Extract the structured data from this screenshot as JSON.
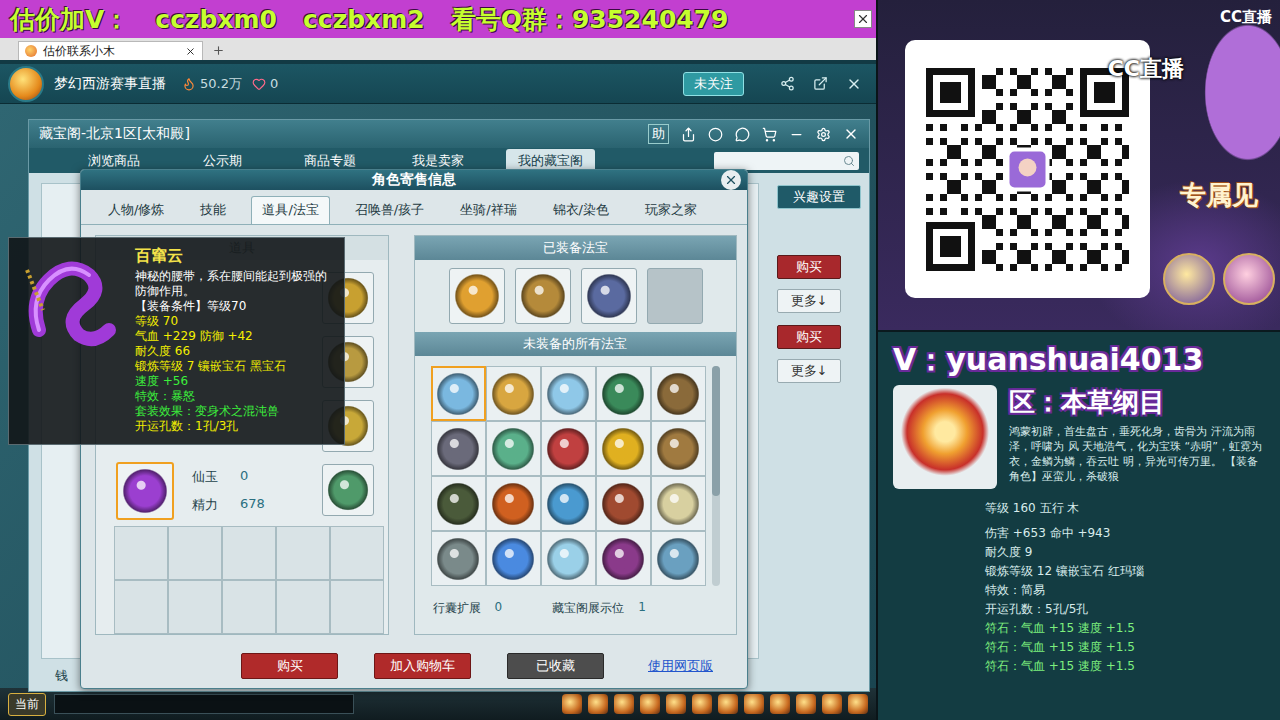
{
  "banner": {
    "segments": [
      "估价加V：",
      "cczbxm0",
      "cczbxm2",
      "看号Q群：935240479"
    ]
  },
  "browser": {
    "tabs": [
      {
        "label": "估价联系小木",
        "selected": true
      }
    ]
  },
  "stream": {
    "title": "梦幻西游赛事直播",
    "heat": "50.2万",
    "likes": "0",
    "follow": "未关注"
  },
  "shop": {
    "title": "藏宝阁-北京1区[太和殿]",
    "help": "助",
    "tabs": [
      {
        "label": "浏览商品",
        "selected": false
      },
      {
        "label": "公示期",
        "selected": false
      },
      {
        "label": "商品专题",
        "selected": false
      },
      {
        "label": "我是卖家",
        "selected": false
      },
      {
        "label": "我的藏宝阁",
        "selected": true
      }
    ],
    "interest": "兴趣设置",
    "listings": [
      {
        "buy": "购买",
        "more": "更多↓"
      },
      {
        "buy": "购买",
        "more": "更多↓"
      }
    ],
    "money": "钱"
  },
  "dialog": {
    "title": "角色寄售信息",
    "tabs": [
      {
        "label": "人物/修炼",
        "selected": false
      },
      {
        "label": "技能",
        "selected": false
      },
      {
        "label": "道具/法宝",
        "selected": true
      },
      {
        "label": "召唤兽/孩子",
        "selected": false
      },
      {
        "label": "坐骑/祥瑞",
        "selected": false
      },
      {
        "label": "锦衣/染色",
        "selected": false
      },
      {
        "label": "玩家之家",
        "selected": false
      }
    ],
    "inventory": {
      "header": "道具",
      "stats": [
        {
          "label": "仙玉",
          "value": "0"
        },
        {
          "label": "精力",
          "value": "678"
        }
      ],
      "belt": {
        "color": "#9b3fd0",
        "selected": true
      },
      "side_items": [
        {
          "color": "#c8a030"
        },
        {
          "color": "#b89a40"
        },
        {
          "color": "#c8a838"
        },
        {
          "color": "#4f9a6a"
        }
      ]
    },
    "equipped": {
      "title": "已装备法宝",
      "slots": [
        {
          "filled": true,
          "color": "#e0a030"
        },
        {
          "filled": true,
          "color": "#b58a3a"
        },
        {
          "filled": true,
          "color": "#5a6aa0"
        },
        {
          "filled": false,
          "color": "#9aa8ad"
        }
      ]
    },
    "unequipped": {
      "title": "未装备的所有法宝",
      "items": [
        {
          "color": "#7ab8e0",
          "selected": true
        },
        {
          "color": "#d8a640",
          "selected": false
        },
        {
          "color": "#8fc8e8",
          "selected": false
        },
        {
          "color": "#3a8a5a",
          "selected": false
        },
        {
          "color": "#8a6a3a",
          "selected": false
        },
        {
          "color": "#6a6a7a",
          "selected": false
        },
        {
          "color": "#5ab08a",
          "selected": false
        },
        {
          "color": "#c04040",
          "selected": false
        },
        {
          "color": "#e0b020",
          "selected": false
        },
        {
          "color": "#a07a40",
          "selected": false
        },
        {
          "color": "#4a5a3a",
          "selected": false
        },
        {
          "color": "#d06020",
          "selected": false
        },
        {
          "color": "#4a9ad0",
          "selected": false
        },
        {
          "color": "#a04a30",
          "selected": false
        },
        {
          "color": "#d8d0a0",
          "selected": false
        },
        {
          "color": "#7a8a8a",
          "selected": false
        },
        {
          "color": "#4a8ae0",
          "selected": false
        },
        {
          "color": "#9ad0e8",
          "selected": false
        },
        {
          "color": "#8a3a8a",
          "selected": false
        },
        {
          "color": "#6aa0c0",
          "selected": false
        }
      ]
    },
    "footer": [
      {
        "label": "行囊扩展",
        "value": "0"
      },
      {
        "label": "藏宝阁展示位",
        "value": "1"
      }
    ],
    "buttons": [
      {
        "label": "购买",
        "kind": "primary"
      },
      {
        "label": "加入购物车",
        "kind": "primary"
      },
      {
        "label": "已收藏",
        "kind": "muted"
      }
    ],
    "link": "使用网页版"
  },
  "tooltip": {
    "name": "百窜云",
    "lines": [
      {
        "text": "神秘的腰带，系在腰间能起到极强的防御作用。",
        "color": "#ffffff"
      },
      {
        "text": "【装备条件】等级70",
        "color": "#ffffff"
      },
      {
        "text": "等级 70",
        "color": "#f4f000"
      },
      {
        "text": "气血 +229 防御 +42",
        "color": "#f4f000"
      },
      {
        "text": "耐久度 66",
        "color": "#f4f000"
      },
      {
        "text": "锻炼等级 7  镶嵌宝石 黑宝石",
        "color": "#f4f000"
      },
      {
        "text": "速度 +56",
        "color": "#3cf03c"
      },
      {
        "text": "特效：暴怒",
        "color": "#3cf03c"
      },
      {
        "text": "套装效果：变身术之混沌兽",
        "color": "#3cf03c"
      },
      {
        "text": "开运孔数：1孔/3孔",
        "color": "#f4f000"
      }
    ]
  },
  "taskbar": {
    "channel": "当前"
  },
  "ad": {
    "corner_logo": "CC直播",
    "qr_logo": "CC直播",
    "slogan": "专属见",
    "contact": "V：yuanshuai4013",
    "zone": "区：本草纲目",
    "description": [
      "鸿蒙初辟，首生盘古，垂死化身，齿骨为",
      "汗流为雨泽，呼啸为",
      "风",
      "天地浩气，化为宝珠",
      "“赤明”，虹霓为衣，金鳞为鳞，吞云吐",
      "明，异光可传万里。",
      "【装备角色】巫蛮儿，杀破狼"
    ],
    "stats": [
      {
        "text": "等级 160 五行 木",
        "color": "#d8ecec"
      },
      {
        "text": "伤害 +653 命中 +943",
        "color": "#d8ecec"
      },
      {
        "text": "耐久度 9",
        "color": "#d8ecec"
      },
      {
        "text": "锻炼等级 12 镶嵌宝石 红玛瑙",
        "color": "#d8ecec"
      },
      {
        "text": "特效：简易",
        "color": "#d8ecec"
      },
      {
        "text": "开运孔数：5孔/5孔",
        "color": "#d8ecec"
      },
      {
        "text": "符石：气血 +15 速度 +1.5",
        "color": "#7ef07e"
      },
      {
        "text": "符石：气血 +15 速度 +1.5",
        "color": "#7ef07e"
      },
      {
        "text": "符石：气血 +15 速度 +1.5",
        "color": "#7ef07e"
      }
    ]
  }
}
